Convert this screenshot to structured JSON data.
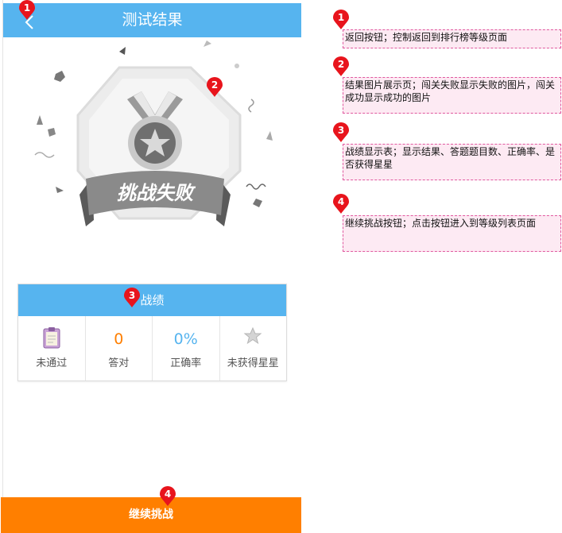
{
  "header": {
    "title": "测试结果"
  },
  "badge": {
    "banner_text": "挑战失败"
  },
  "results": {
    "header": "战绩",
    "cells": [
      {
        "label": "未通过"
      },
      {
        "value": "0",
        "label": "答对"
      },
      {
        "value": "0%",
        "label": "正确率"
      },
      {
        "label": "未获得星星"
      }
    ]
  },
  "continue_button": {
    "label": "继续挑战"
  },
  "markers": [
    "1",
    "2",
    "3",
    "4"
  ],
  "notes": [
    {
      "number": "1",
      "text": "返回按钮；控制返回到排行榜等级页面"
    },
    {
      "number": "2",
      "text": "结果图片展示页；闯关失败显示失败的图片，闯关成功显示成功的图片"
    },
    {
      "number": "3",
      "text": "战绩显示表；显示结果、答题题目数、正确率、是否获得星星"
    },
    {
      "number": "4",
      "text": "继续挑战按钮；点击按钮进入到等级列表页面"
    }
  ],
  "colors": {
    "header": "#56b4ef",
    "continue": "#ff7f00",
    "value_zero": "#ff7f00",
    "value_rate": "#56b4ef",
    "marker": "#e8141c",
    "note_border": "#e0599f",
    "note_bg": "#fdeaf3"
  }
}
